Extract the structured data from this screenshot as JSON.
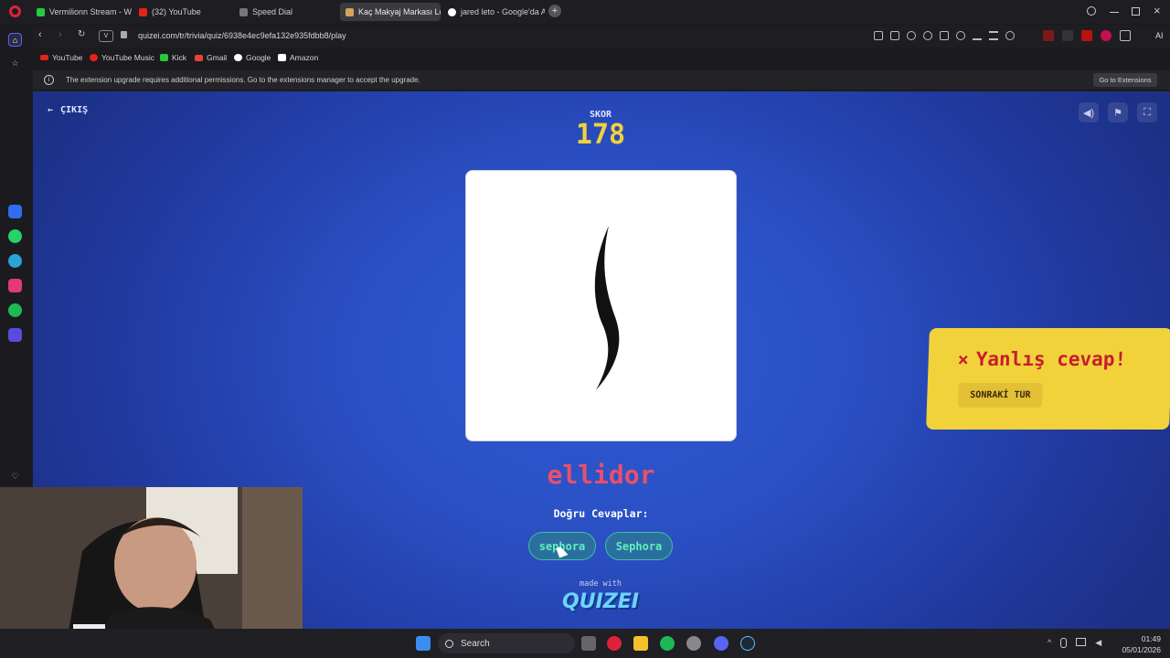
{
  "browser": {
    "tabs": [
      {
        "label": "Vermilionn Stream - Watc",
        "color": "#27c93f"
      },
      {
        "label": "(32) YouTube",
        "color": "#e62117"
      },
      {
        "label": "Speed Dial",
        "color": "#888888"
      },
      {
        "label": "Kaç Makyaj Markası Logo",
        "color": "#d4a35a"
      },
      {
        "label": "jared leto - Google'da Ara",
        "color": "#4285f4"
      }
    ],
    "url": "quizei.com/tr/trivia/quiz/6938e4ec9efa132e935fdbb8/play",
    "lock_text": "V",
    "bookmarks": [
      "YouTube",
      "YouTube Music",
      "Kick",
      "Gmail",
      "Google",
      "Amazon"
    ],
    "info_text": "The extension upgrade requires additional permissions. Go to the extensions manager to accept the upgrade.",
    "info_button": "Go to Extensions",
    "ai_label": "AI"
  },
  "quiz": {
    "exit_label": "ÇIKIŞ",
    "score_label": "SKOR",
    "score_value": "178",
    "wrong_answer_given": "ellidor",
    "correct_answers_label": "Doğru Cevaplar:",
    "correct_answers": [
      "sephora",
      "Sephora"
    ],
    "toast_title": "Yanlış cevap!",
    "toast_icon": "×",
    "next_round_label": "SONRAKİ TUR",
    "made_with": "made with",
    "brand": "QUIZEI",
    "colors": {
      "score": "#f2d23b",
      "wrong": "#e8506a",
      "toast": "#f2d23b",
      "chip_text": "#5ff0b8"
    }
  },
  "taskbar": {
    "search_label": "Search",
    "time": "01:49",
    "date": "05/01/2026"
  }
}
